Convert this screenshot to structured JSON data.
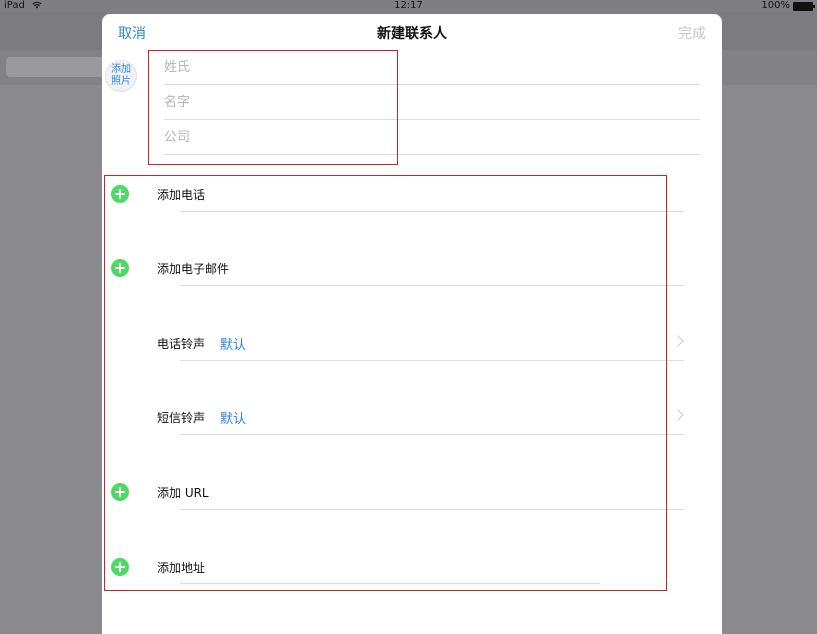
{
  "status_bar": {
    "device": "iPad",
    "time": "12:17",
    "battery": "100%"
  },
  "sheet": {
    "cancel_label": "取消",
    "title": "新建联系人",
    "done_label": "完成",
    "photo_label_line1": "添加",
    "photo_label_line2": "照片"
  },
  "name_fields": {
    "last_name_placeholder": "姓氏",
    "first_name_placeholder": "名字",
    "company_placeholder": "公司"
  },
  "rows": {
    "add_phone": "添加电话",
    "add_email": "添加电子邮件",
    "ringtone_label": "电话铃声",
    "ringtone_value": "默认",
    "text_tone_label": "短信铃声",
    "text_tone_value": "默认",
    "add_url": "添加 URL",
    "add_address": "添加地址"
  },
  "colors": {
    "accent_blue": "#2a86d6",
    "add_green": "#4cd964",
    "highlight_red": "#c0282c",
    "disabled_gray": "#c7c7cc"
  }
}
